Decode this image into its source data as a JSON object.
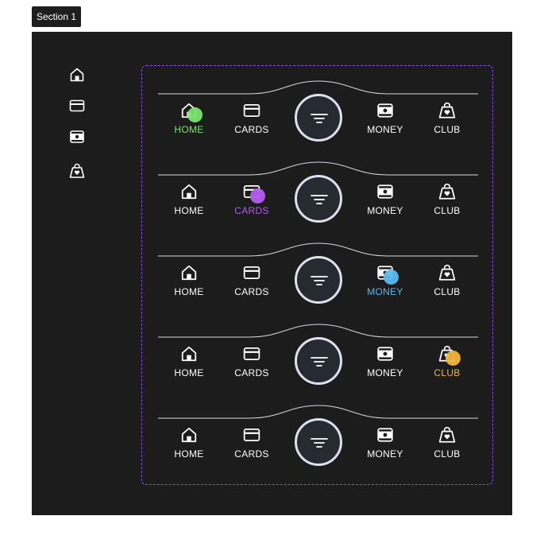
{
  "section": {
    "label": "Section 1"
  },
  "sidebar_icons": [
    "home-icon",
    "card-icon",
    "money-icon",
    "bag-icon"
  ],
  "nav_labels": {
    "home": "HOME",
    "cards": "CARDS",
    "money": "MONEY",
    "club": "CLUB"
  },
  "fab": {
    "icon": "filter-icon"
  },
  "variants": [
    {
      "active": "home",
      "accent": "#7be36f"
    },
    {
      "active": "cards",
      "accent": "#b35cf2"
    },
    {
      "active": "money",
      "accent": "#57b9ee"
    },
    {
      "active": "club",
      "accent": "#f0b53a"
    },
    {
      "active": "none",
      "accent": ""
    }
  ],
  "colors": {
    "frame_bg": "#1c1c1c",
    "text": "#ffffff",
    "outline": "#8a4cf0",
    "fab_ring": "#dfe0ef"
  }
}
